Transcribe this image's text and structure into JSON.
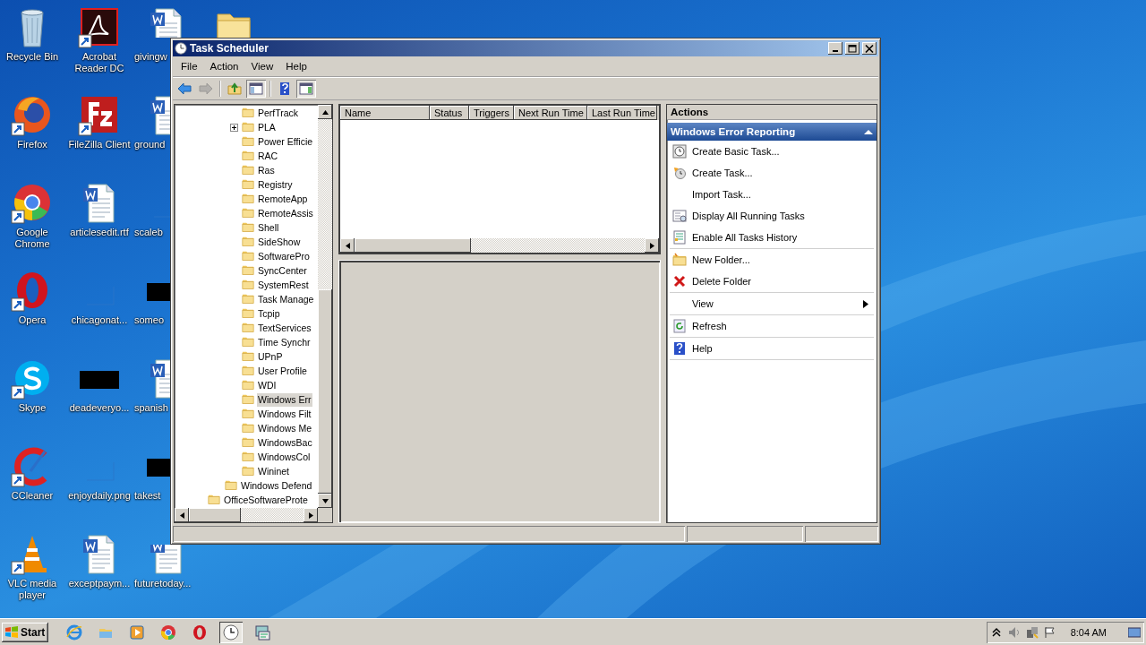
{
  "desktop": {
    "icons": [
      {
        "label": "Recycle Bin",
        "kind": "recycle",
        "shortcut": false
      },
      {
        "label": "Firefox",
        "kind": "firefox",
        "shortcut": true
      },
      {
        "label": "Google Chrome",
        "kind": "chrome",
        "shortcut": true
      },
      {
        "label": "Opera",
        "kind": "opera",
        "shortcut": true
      },
      {
        "label": "Skype",
        "kind": "skype",
        "shortcut": true
      },
      {
        "label": "CCleaner",
        "kind": "ccleaner",
        "shortcut": true
      },
      {
        "label": "VLC media player",
        "kind": "vlc",
        "shortcut": true
      },
      {
        "label": "Acrobat Reader DC",
        "kind": "acrobat",
        "shortcut": true
      },
      {
        "label": "FileZilla Client",
        "kind": "filezilla",
        "shortcut": true
      },
      {
        "label": "articlesedit.rtf",
        "kind": "word",
        "shortcut": false
      },
      {
        "label": "chicagonat...",
        "kind": "blank",
        "shortcut": false
      },
      {
        "label": "deadeveryo...",
        "kind": "black",
        "shortcut": false
      },
      {
        "label": "enjoydaily.png",
        "kind": "blank",
        "shortcut": false
      },
      {
        "label": "exceptpaym...",
        "kind": "word",
        "shortcut": false
      },
      {
        "label": "givingw",
        "kind": "word",
        "shortcut": false
      },
      {
        "label": "ground",
        "kind": "word",
        "shortcut": false
      },
      {
        "label": "scaleb",
        "kind": "blank",
        "shortcut": false
      },
      {
        "label": "someo",
        "kind": "black",
        "shortcut": false
      },
      {
        "label": "spanish",
        "kind": "word",
        "shortcut": false
      },
      {
        "label": "takest",
        "kind": "black",
        "shortcut": false
      },
      {
        "label": "futuretoday...",
        "kind": "word",
        "shortcut": false
      },
      {
        "kind": "folder",
        "shortcut": false
      }
    ]
  },
  "window": {
    "title": "Task Scheduler",
    "menu": [
      "File",
      "Action",
      "View",
      "Help"
    ],
    "toolbar": [
      {
        "kind": "back",
        "disabled": false,
        "pressed": false
      },
      {
        "kind": "forward",
        "disabled": true,
        "pressed": false
      },
      {
        "kind": "up",
        "disabled": false,
        "pressed": false
      },
      {
        "kind": "tree",
        "disabled": false,
        "pressed": true
      },
      {
        "kind": "help",
        "disabled": false,
        "pressed": false
      },
      {
        "kind": "pane",
        "disabled": false,
        "pressed": true
      }
    ],
    "tree": {
      "items": [
        {
          "children": [
            {
              "children": [
                {
                  "children": [
                    {
                      "children": [
                        {
                          "label": "PerfTrack",
                          "expander": false,
                          "selected": false
                        },
                        {
                          "label": "PLA",
                          "expander": true,
                          "selected": false
                        },
                        {
                          "label": "Power Efficie",
                          "expander": false,
                          "selected": false
                        },
                        {
                          "label": "RAC",
                          "expander": false,
                          "selected": false
                        },
                        {
                          "label": "Ras",
                          "expander": false,
                          "selected": false
                        },
                        {
                          "label": "Registry",
                          "expander": false,
                          "selected": false
                        },
                        {
                          "label": "RemoteApp",
                          "expander": false,
                          "selected": false
                        },
                        {
                          "label": "RemoteAssis",
                          "expander": false,
                          "selected": false
                        },
                        {
                          "label": "Shell",
                          "expander": false,
                          "selected": false
                        },
                        {
                          "label": "SideShow",
                          "expander": false,
                          "selected": false
                        },
                        {
                          "label": "SoftwarePro",
                          "expander": false,
                          "selected": false
                        },
                        {
                          "label": "SyncCenter",
                          "expander": false,
                          "selected": false
                        },
                        {
                          "label": "SystemRest",
                          "expander": false,
                          "selected": false
                        },
                        {
                          "label": "Task Manage",
                          "expander": false,
                          "selected": false
                        },
                        {
                          "label": "Tcpip",
                          "expander": false,
                          "selected": false
                        },
                        {
                          "label": "TextServices",
                          "expander": false,
                          "selected": false
                        },
                        {
                          "label": "Time Synchr",
                          "expander": false,
                          "selected": false
                        },
                        {
                          "label": "UPnP",
                          "expander": false,
                          "selected": false
                        },
                        {
                          "label": "User Profile",
                          "expander": false,
                          "selected": false
                        },
                        {
                          "label": "WDI",
                          "expander": false,
                          "selected": false
                        },
                        {
                          "label": "Windows Err",
                          "expander": false,
                          "selected": true
                        },
                        {
                          "label": "Windows Filt",
                          "expander": false,
                          "selected": false
                        },
                        {
                          "label": "Windows Me",
                          "expander": false,
                          "selected": false
                        },
                        {
                          "label": "WindowsBac",
                          "expander": false,
                          "selected": false
                        },
                        {
                          "label": "WindowsCol",
                          "expander": false,
                          "selected": false
                        },
                        {
                          "label": "Wininet",
                          "expander": false,
                          "selected": false
                        }
                      ]
                    },
                    {
                      "label": "Windows Defend",
                      "expander": false,
                      "selected": false
                    }
                  ]
                },
                {
                  "label": "OfficeSoftwareProte",
                  "expander": false,
                  "selected": false
                }
              ]
            }
          ]
        }
      ]
    },
    "table": {
      "columns": [
        "Name",
        "Status",
        "Triggers",
        "Next Run Time",
        "Last Run Time"
      ]
    },
    "actions": {
      "title": "Actions",
      "section": {
        "title": "Windows Error Reporting",
        "expanded": true
      },
      "groups": [
        [
          {
            "label": "Create Basic Task...",
            "kind": "wizard",
            "submenu": false
          },
          {
            "label": "Create Task...",
            "kind": "task",
            "submenu": false
          },
          {
            "label": "Import Task...",
            "kind": "plain",
            "submenu": false
          },
          {
            "label": "Display All Running Tasks",
            "kind": "running",
            "submenu": false
          },
          {
            "label": "Enable All Tasks History",
            "kind": "history",
            "submenu": false
          }
        ],
        [
          {
            "label": "New Folder...",
            "kind": "folder",
            "submenu": false
          },
          {
            "label": "Delete Folder",
            "kind": "delete",
            "submenu": false
          }
        ],
        [
          {
            "label": "View",
            "kind": "plain",
            "submenu": true
          }
        ],
        [
          {
            "label": "Refresh",
            "kind": "refresh",
            "submenu": false
          }
        ],
        [
          {
            "label": "Help",
            "kind": "help",
            "submenu": false
          }
        ]
      ]
    }
  },
  "taskbar": {
    "start": "Start",
    "apps": [
      {
        "kind": "ie",
        "selected": false
      },
      {
        "kind": "explorer",
        "selected": false
      },
      {
        "kind": "media",
        "selected": false
      },
      {
        "kind": "chrome",
        "selected": false
      },
      {
        "kind": "opera",
        "selected": false
      },
      {
        "kind": "scheduler",
        "selected": true
      },
      {
        "kind": "tool",
        "selected": false
      }
    ],
    "tray": {
      "time": "8:04 AM"
    }
  }
}
